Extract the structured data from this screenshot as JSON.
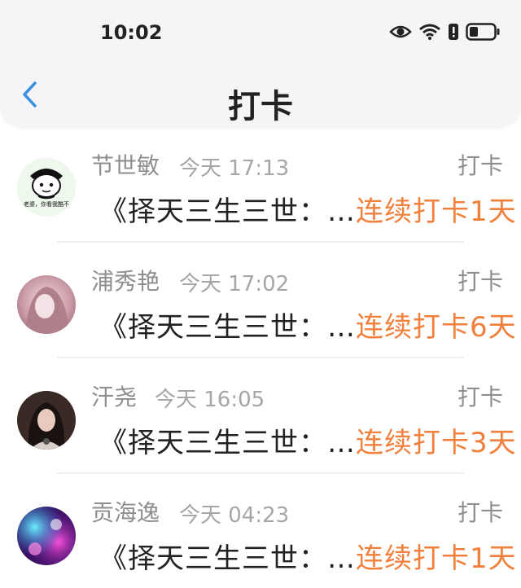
{
  "status_bar": {
    "time": "10:02"
  },
  "nav": {
    "title": "打卡",
    "back_icon": "chevron-left-icon",
    "accent_color": "#3b8fe0"
  },
  "records": [
    {
      "name": "节世敏",
      "time": "今天 17:13",
      "type": "打卡",
      "content": "《择天三生三世：…",
      "streak": "连续打卡1天",
      "avatar_caption": "老婆，你看我酷不"
    },
    {
      "name": "浦秀艳",
      "time": "今天 17:02",
      "type": "打卡",
      "content": "《择天三生三世：…",
      "streak": "连续打卡6天"
    },
    {
      "name": "汗尧",
      "time": "今天 16:05",
      "type": "打卡",
      "content": "《择天三生三世：…",
      "streak": "连续打卡3天"
    },
    {
      "name": "贡海逸",
      "time": "今天 04:23",
      "type": "打卡",
      "content": "《择天三生三世：…",
      "streak": "连续打卡1天"
    }
  ],
  "colors": {
    "streak": "#f0803c",
    "header_bg": "#f5f5f7"
  }
}
